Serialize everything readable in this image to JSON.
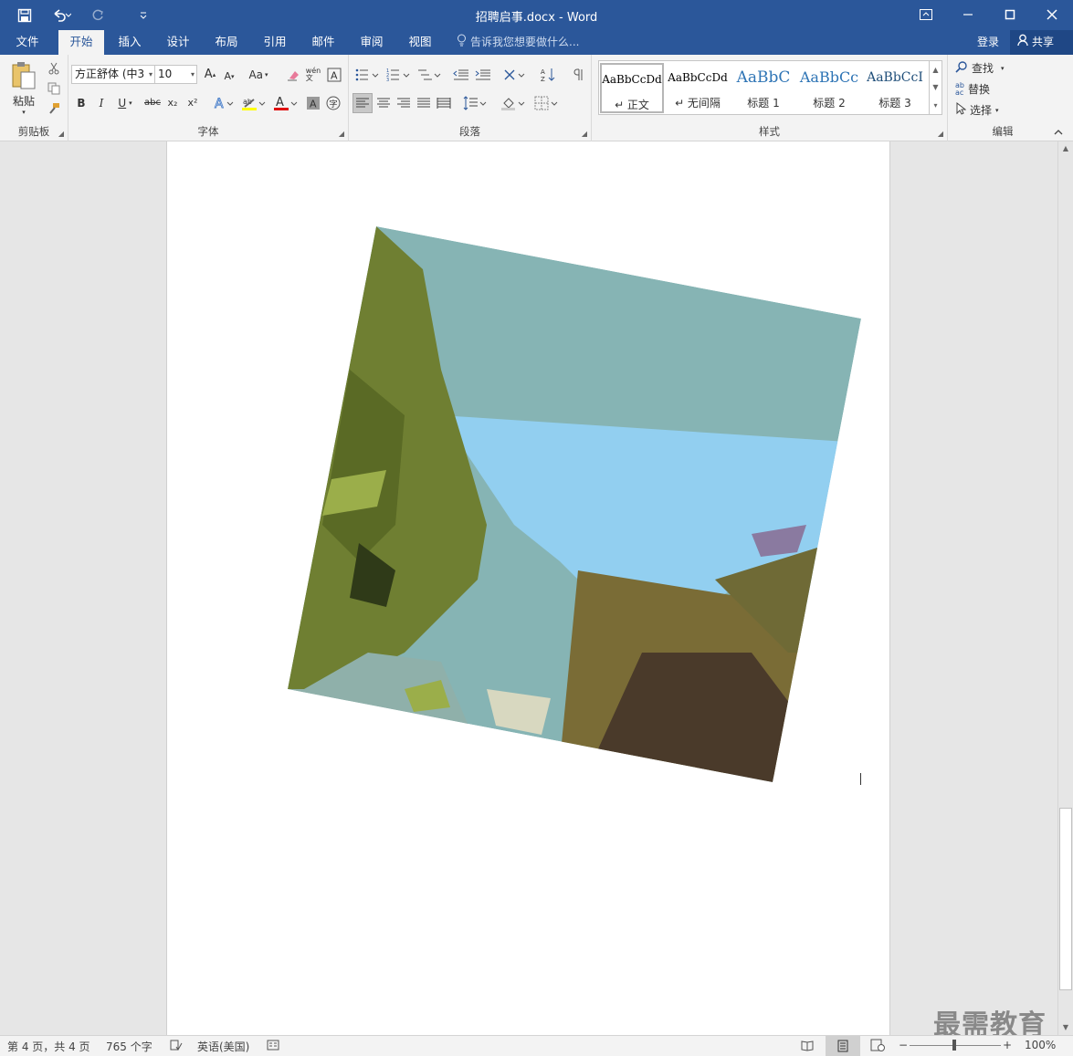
{
  "window": {
    "title": "招聘启事.docx - Word"
  },
  "quick_access": {
    "icons": [
      "save-icon",
      "undo-icon",
      "redo-icon",
      "customize-icon"
    ]
  },
  "tabs": [
    {
      "label": "文件"
    },
    {
      "label": "开始",
      "active": true
    },
    {
      "label": "插入"
    },
    {
      "label": "设计"
    },
    {
      "label": "布局"
    },
    {
      "label": "引用"
    },
    {
      "label": "邮件"
    },
    {
      "label": "审阅"
    },
    {
      "label": "视图"
    }
  ],
  "tell_me": "告诉我您想要做什么...",
  "account": {
    "login": "登录",
    "share": "共享"
  },
  "ribbon": {
    "clipboard": {
      "paste": "粘贴",
      "label": "剪贴板"
    },
    "font": {
      "name": "方正舒体 (中3",
      "size": "10",
      "grow": "A",
      "shrink": "A",
      "change_case": "Aa",
      "bold": "B",
      "italic": "I",
      "underline": "U",
      "strike": "abc",
      "subscript": "x₂",
      "superscript": "x²",
      "label": "字体"
    },
    "paragraph": {
      "label": "段落"
    },
    "styles": {
      "items": [
        {
          "sample": "AaBbCcDd",
          "name": "↵ 正文"
        },
        {
          "sample": "AaBbCcDd",
          "name": "↵ 无间隔"
        },
        {
          "sample": "AaBbC",
          "name": "标题 1"
        },
        {
          "sample": "AaBbCc",
          "name": "标题 2"
        },
        {
          "sample": "AaBbCcI",
          "name": "标题 3"
        }
      ],
      "label": "样式"
    },
    "editing": {
      "find": "查找",
      "replace": "替换",
      "select": "选择",
      "label": "编辑"
    }
  },
  "status": {
    "page": "第 4 页，共 4 页",
    "words": "765 个字",
    "language": "英语(美国)",
    "zoom": "100%"
  },
  "watermark": "最需教育",
  "colors": {
    "accent": "#2b579a",
    "sky": "#86b4b4",
    "sky_light": "#92cff0",
    "foliage": "#6f7f32",
    "dark_foliage": "#4a3a2a"
  }
}
